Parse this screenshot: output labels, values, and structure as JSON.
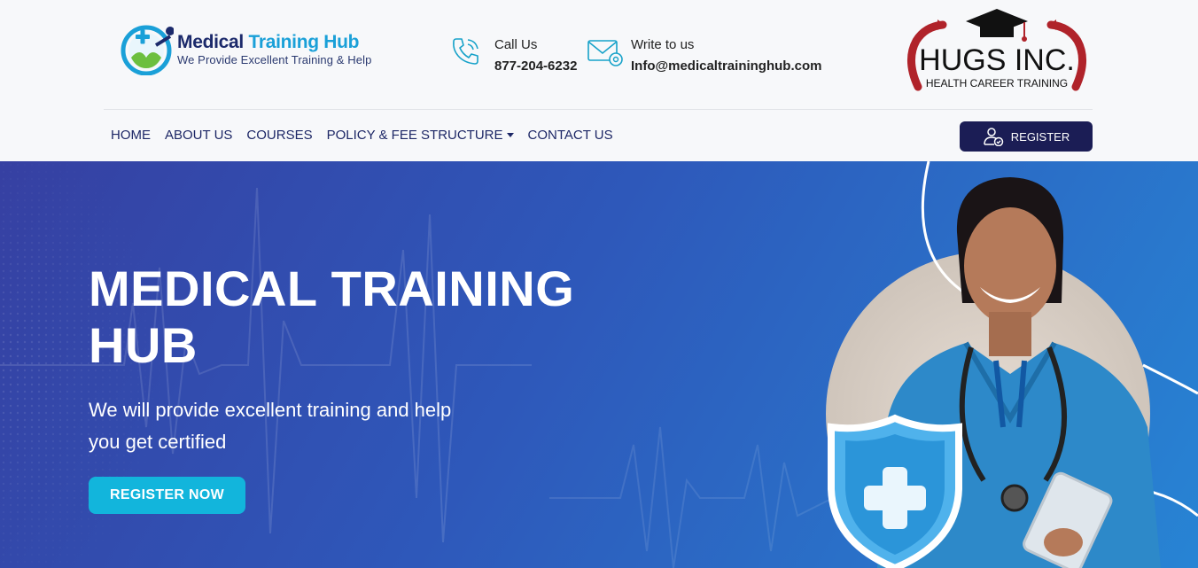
{
  "brand": {
    "title_part1": "Medical",
    "title_part2": "Training Hub",
    "tagline": "We Provide Excellent Training & Help"
  },
  "contact": {
    "phone_label": "Call Us",
    "phone_value": "877-204-6232",
    "email_label": "Write to us",
    "email_value": "Info@medicaltraininghub.com"
  },
  "partner": {
    "name": "HUGS INC.",
    "subtitle": "HEALTH CAREER TRAINING"
  },
  "nav": {
    "items": [
      {
        "label": "HOME"
      },
      {
        "label": "ABOUT US"
      },
      {
        "label": "COURSES"
      },
      {
        "label": "POLICY & FEE STRUCTURE"
      },
      {
        "label": "CONTACT US"
      }
    ],
    "register_label": "REGISTER"
  },
  "hero": {
    "title": "MEDICAL TRAINING HUB",
    "subtitle": "We will provide excellent training and help you get certified",
    "cta_label": "REGISTER NOW"
  },
  "icons": {
    "phone": "phone-icon",
    "email": "email-icon",
    "register": "user-check-icon",
    "dropdown": "chevron-down-icon"
  },
  "colors": {
    "navy": "#1b1d55",
    "accent": "#12b5dc",
    "hero_start": "#3640a2",
    "hero_end": "#2784d4",
    "hugs_red": "#b0232a"
  }
}
